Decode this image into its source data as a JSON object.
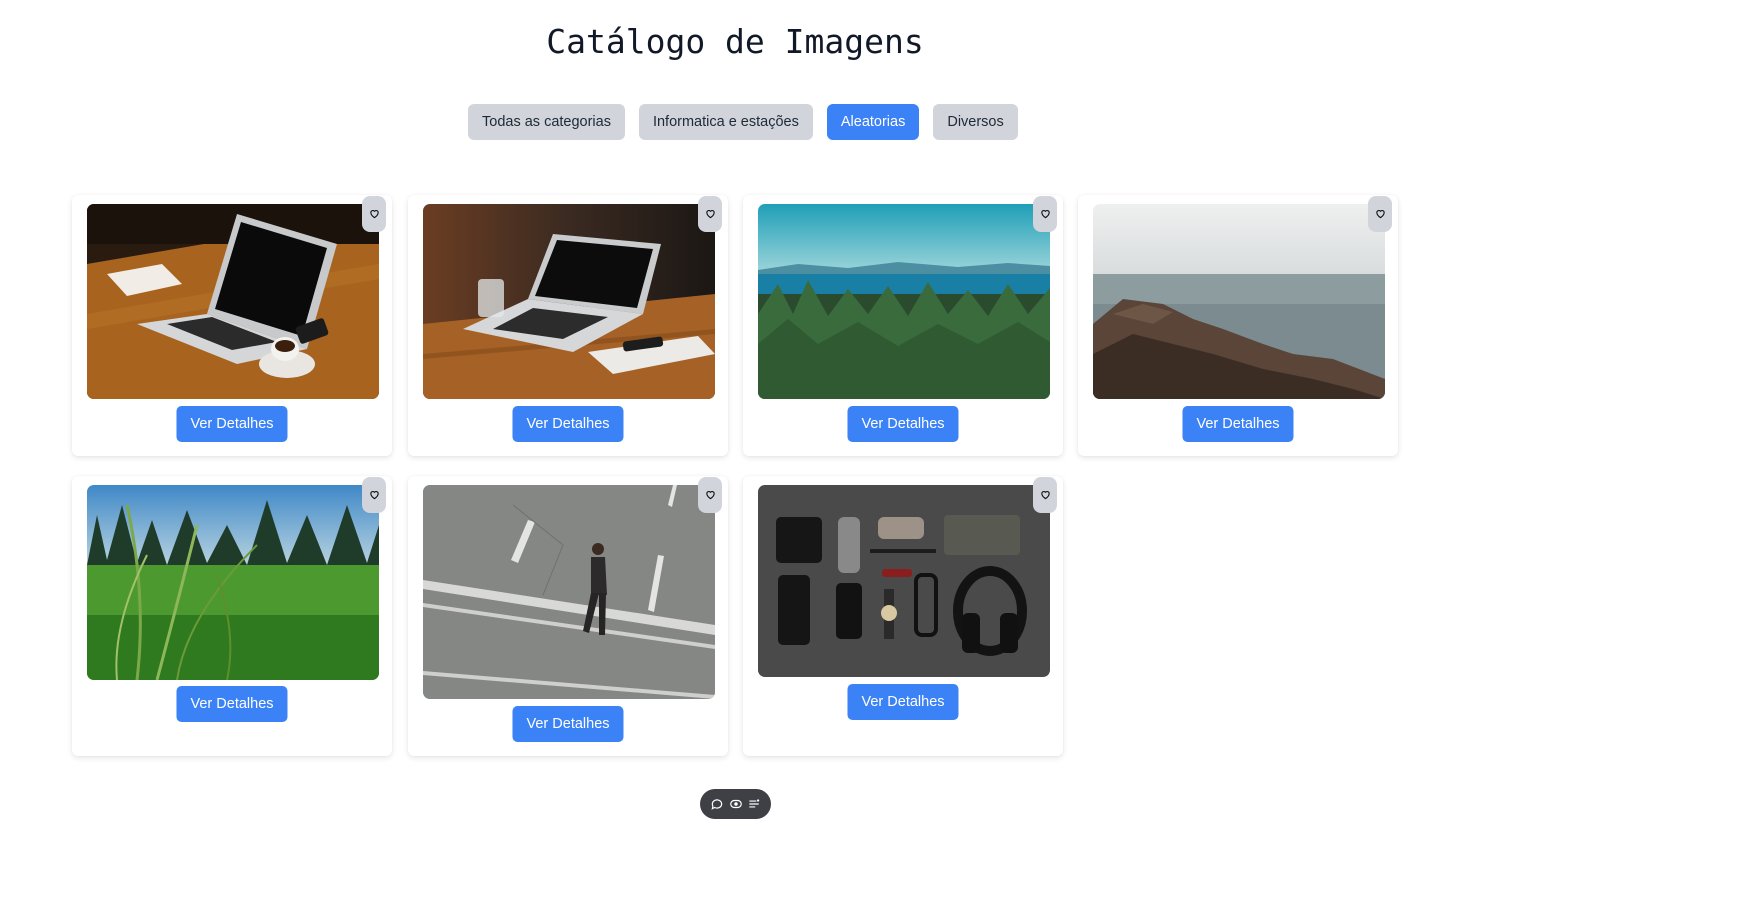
{
  "page": {
    "title": "Catálogo de Imagens"
  },
  "filters": [
    {
      "label": "Todas as categorias",
      "active": false
    },
    {
      "label": "Informatica e estações",
      "active": false
    },
    {
      "label": "Aleatorias",
      "active": true
    },
    {
      "label": "Diversos",
      "active": false
    }
  ],
  "cards": [
    {
      "image": "laptop-coffee-desk-photo",
      "button": "Ver Detalhes"
    },
    {
      "image": "laptop-wooden-table-photo",
      "button": "Ver Detalhes"
    },
    {
      "image": "forest-lake-mountains-photo",
      "button": "Ver Detalhes"
    },
    {
      "image": "rocky-coast-sea-photo",
      "button": "Ver Detalhes"
    },
    {
      "image": "grass-field-forest-photo",
      "button": "Ver Detalhes"
    },
    {
      "image": "man-walking-road-photo",
      "button": "Ver Detalhes"
    },
    {
      "image": "flatlay-accessories-photo",
      "button": "Ver Detalhes"
    }
  ],
  "icons": {
    "favorite": "heart-icon",
    "toolbar": [
      "comment-icon",
      "eye-icon",
      "list-settings-icon"
    ]
  },
  "colors": {
    "accent": "#3b82f6",
    "chip": "#d1d5db",
    "toolbar": "#3f3f46"
  }
}
